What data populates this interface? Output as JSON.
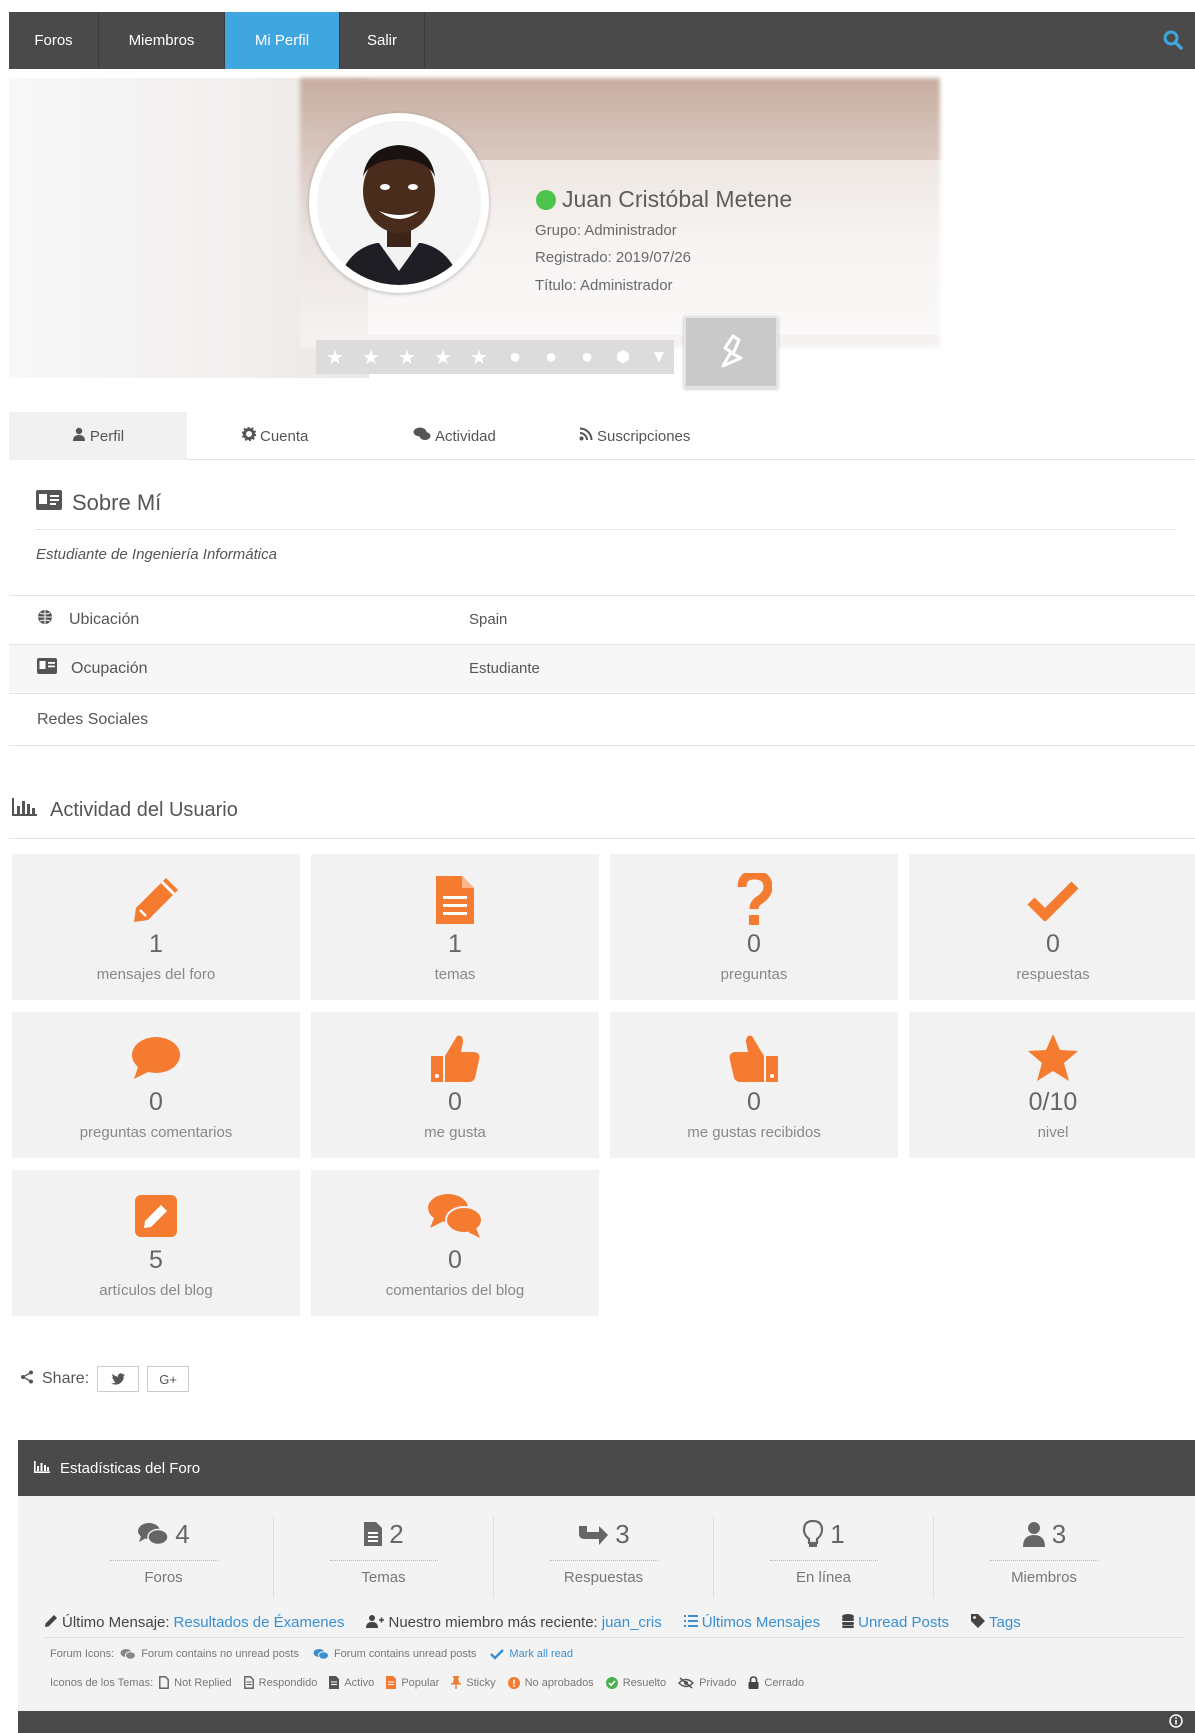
{
  "nav": {
    "items": [
      {
        "label": "Foros"
      },
      {
        "label": "Miembros"
      },
      {
        "label": "Mi Perfil"
      },
      {
        "label": "Salir"
      }
    ],
    "accent": "#3fa6e0"
  },
  "profile": {
    "name": "Juan Cristóbal Metene",
    "group": "Grupo: Administrador",
    "registered": "Registrado: 2019/07/26",
    "title": "Título: Administrador",
    "status": "online",
    "rating_icons": [
      "star",
      "star",
      "star",
      "star",
      "star",
      "circle",
      "circle",
      "circle",
      "shield",
      "trophy"
    ]
  },
  "tabs": [
    {
      "label": "Perfil",
      "icon": "user-icon"
    },
    {
      "label": "Cuenta",
      "icon": "gear-icon"
    },
    {
      "label": "Actividad",
      "icon": "comments-icon"
    },
    {
      "label": "Suscripciones",
      "icon": "rss-icon"
    }
  ],
  "about": {
    "title": "Sobre Mí",
    "text": "Estudiante de Ingeniería Informática",
    "rows": [
      {
        "label": "Ubicación",
        "value": "Spain"
      },
      {
        "label": "Ocupación",
        "value": "Estudiante"
      },
      {
        "label": "Redes Sociales",
        "value": ""
      }
    ]
  },
  "activity": {
    "title": "Actividad del Usuario",
    "stats": [
      {
        "icon": "pencil-icon",
        "value": "1",
        "label": "mensajes del foro"
      },
      {
        "icon": "document-icon",
        "value": "1",
        "label": "temas"
      },
      {
        "icon": "question-icon",
        "value": "0",
        "label": "preguntas"
      },
      {
        "icon": "check-icon",
        "value": "0",
        "label": "respuestas"
      },
      {
        "icon": "comment-icon",
        "value": "0",
        "label": "preguntas comentarios"
      },
      {
        "icon": "thumbs-up-icon",
        "value": "0",
        "label": "me gusta"
      },
      {
        "icon": "thumbs-up-received-icon",
        "value": "0",
        "label": "me gustas recibidos"
      },
      {
        "icon": "star-icon",
        "value": "0/10",
        "label": "nivel"
      },
      {
        "icon": "edit-square-icon",
        "value": "5",
        "label": "artículos del blog"
      },
      {
        "icon": "comments-icon",
        "value": "0",
        "label": "comentarios del blog"
      }
    ],
    "icon_color": "#f47b30"
  },
  "share": {
    "label": "Share:",
    "buttons": [
      "twitter-icon",
      "google-plus-icon"
    ],
    "gplus_text": "G+"
  },
  "forum_stats": {
    "title": "Estadísticas del Foro",
    "columns": [
      {
        "icon": "comments-icon",
        "value": "4",
        "label": "Foros"
      },
      {
        "icon": "document-icon",
        "value": "2",
        "label": "Temas"
      },
      {
        "icon": "reply-icon",
        "value": "3",
        "label": "Respuestas"
      },
      {
        "icon": "lightbulb-icon",
        "value": "1",
        "label": "En línea"
      },
      {
        "icon": "user-icon",
        "value": "3",
        "label": "Miembros"
      }
    ],
    "last_post_label": "Último Mensaje:",
    "last_post_link": "Resultados de Éxamenes",
    "newest_member_label": "Nuestro miembro más reciente:",
    "newest_member_link": "juan_cris",
    "latest_posts": "Últimos Mensajes",
    "unread_posts": "Unread Posts",
    "tags": "Tags",
    "forum_icons_label": "Forum Icons:",
    "forum_icons": [
      "Forum contains no unread posts",
      "Forum contains unread posts",
      "Mark all read"
    ],
    "topic_icons_label": "Iconos de los Temas:",
    "topic_icons": [
      "Not Replied",
      "Respondido",
      "Activo",
      "Popular",
      "Sticky",
      "No aprobados",
      "Resuelto",
      "Privado",
      "Cerrado"
    ]
  }
}
